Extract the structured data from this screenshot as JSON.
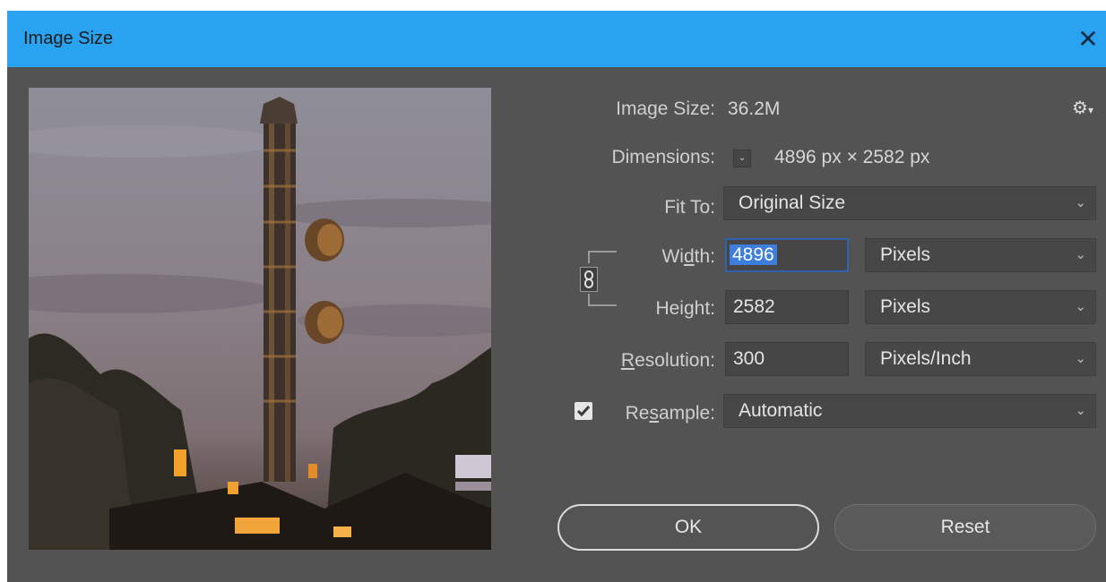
{
  "dialog": {
    "title": "Image Size"
  },
  "info": {
    "image_size_label": "Image Size:",
    "image_size_value": "36.2M",
    "dimensions_label": "Dimensions:",
    "dimensions_value": "4896 px  ×  2582 px"
  },
  "fit_to": {
    "label": "Fit To:",
    "value": "Original Size"
  },
  "width": {
    "label_pre": "Wi",
    "label_u": "d",
    "label_post": "th:",
    "value": "4896",
    "unit": "Pixels"
  },
  "height": {
    "label_pre": "Hei",
    "label_u": "g",
    "label_post": "ht:",
    "value": "2582",
    "unit": "Pixels"
  },
  "resolution": {
    "label_u": "R",
    "label_post": "esolution:",
    "value": "300",
    "unit": "Pixels/Inch"
  },
  "resample": {
    "label_pre": "Re",
    "label_u": "s",
    "label_post": "ample:",
    "checked": true,
    "value": "Automatic"
  },
  "buttons": {
    "ok": "OK",
    "reset": "Reset"
  },
  "icons": {
    "close": "close-icon",
    "gear": "gear-menu-icon",
    "link": "link-constrain-icon",
    "check": "check-icon",
    "chevron": "chevron-down-icon"
  },
  "colors": {
    "titlebar": "#29a3ef",
    "dialog_bg": "#535353",
    "selection": "#3d7edc"
  }
}
